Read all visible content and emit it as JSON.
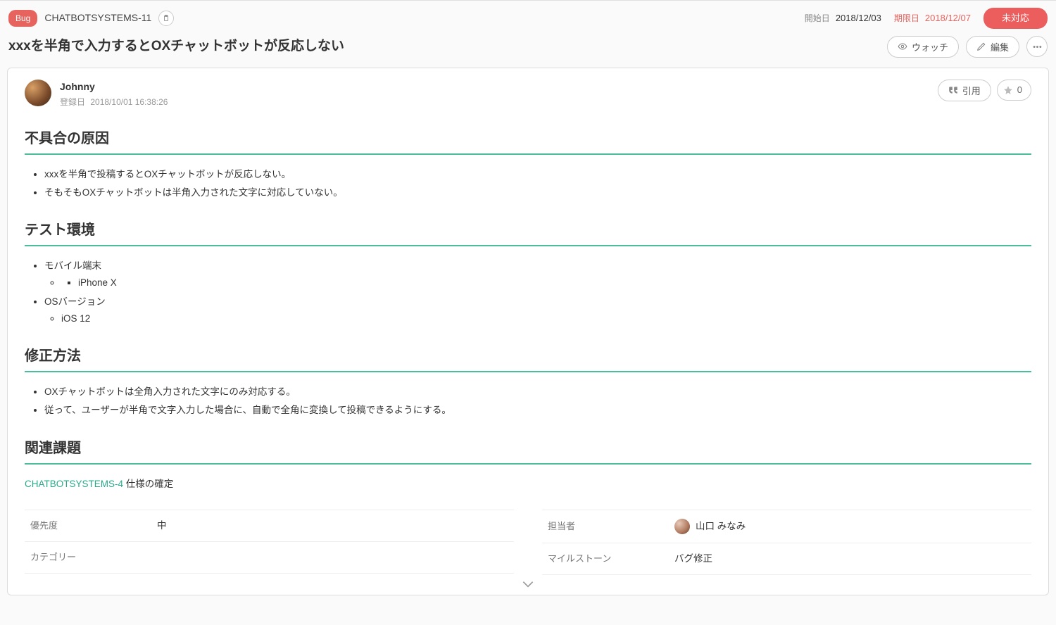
{
  "header": {
    "type_badge": "Bug",
    "issue_key": "CHATBOTSYSTEMS-11",
    "start_label": "開始日",
    "start_date": "2018/12/03",
    "due_label": "期限日",
    "due_date": "2018/12/07",
    "status": "未対応"
  },
  "title": "xxxを半角で入力するとOXチャットボットが反応しない",
  "actions": {
    "watch": "ウォッチ",
    "edit": "編集",
    "quote": "引用",
    "star_count": "0"
  },
  "author": {
    "name": "Johnny",
    "registered_label": "登録日",
    "registered_at": "2018/10/01 16:38:26"
  },
  "sections": {
    "cause_title": "不具合の原因",
    "cause_items": [
      "xxxを半角で投稿するとOXチャットボットが反応しない。",
      "そもそもOXチャットボットは半角入力された文字に対応していない。"
    ],
    "env_title": "テスト環境",
    "env_item1": "モバイル端末",
    "env_item1_sub": "iPhone X",
    "env_item2": "OSバージョン",
    "env_item2_sub": "iOS 12",
    "fix_title": "修正方法",
    "fix_items": [
      "OXチャットボットは全角入力された文字にのみ対応する。",
      "従って、ユーザーが半角で文字入力した場合に、自動で全角に変換して投稿できるようにする。"
    ],
    "related_title": "関連課題",
    "related_link": "CHATBOTSYSTEMS-4",
    "related_text": "仕様の確定"
  },
  "meta": {
    "priority_label": "優先度",
    "priority_value": "中",
    "category_label": "カテゴリー",
    "category_value": "",
    "assignee_label": "担当者",
    "assignee_value": "山口 みなみ",
    "milestone_label": "マイルストーン",
    "milestone_value": "バグ修正"
  }
}
